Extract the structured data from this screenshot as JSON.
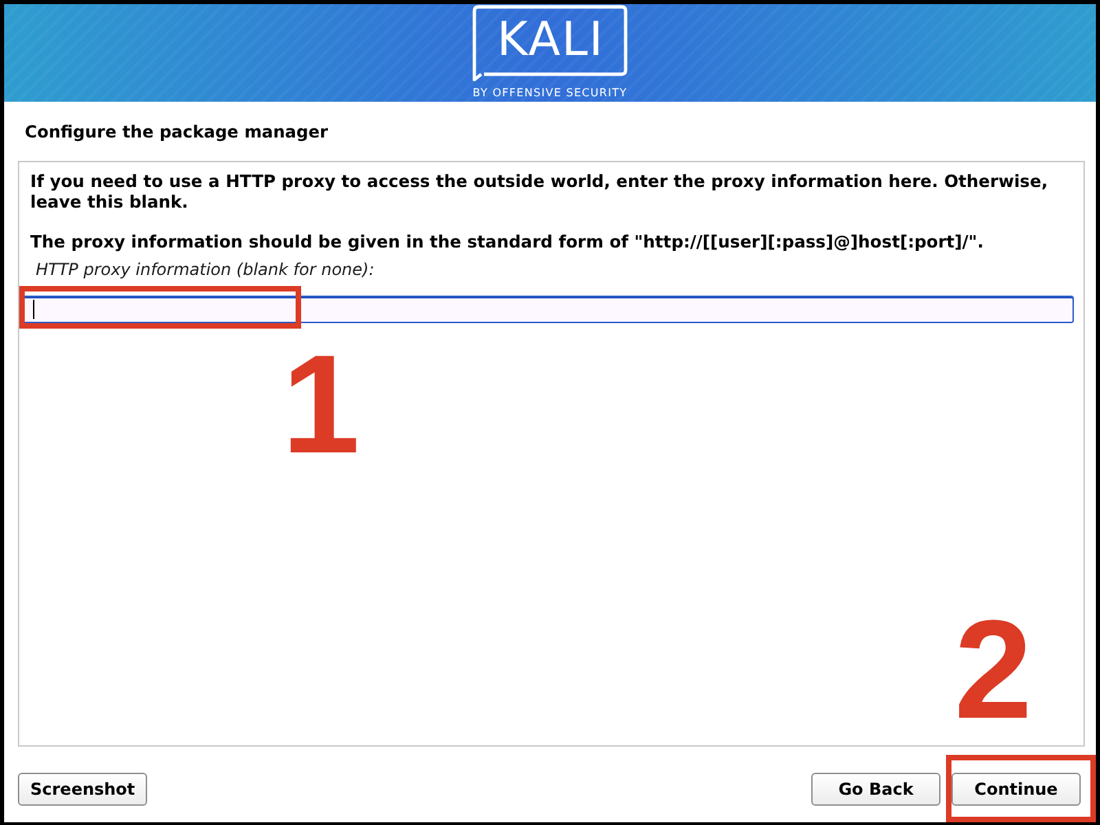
{
  "header": {
    "logo_text": "KALI",
    "logo_tagline": "BY OFFENSIVE SECURITY"
  },
  "page_title": "Configure the package manager",
  "content": {
    "paragraphs": [
      "If you need to use a HTTP proxy to access the outside world, enter the proxy information here. Otherwise, leave this blank.",
      "The proxy information should be given in the standard form of \"http://[[user][:pass]@]host[:port]/\"."
    ],
    "field": {
      "label": "HTTP proxy information (blank for none):",
      "focused": true,
      "highlighted": true
    }
  },
  "annotations": [
    {
      "number": "1"
    },
    {
      "number": "2"
    }
  ],
  "buttons": [
    {
      "label": "Screenshot",
      "highlighted": false
    },
    {
      "label": "Go Back",
      "highlighted": false
    },
    {
      "label": "Continue",
      "highlighted": true
    }
  ]
}
